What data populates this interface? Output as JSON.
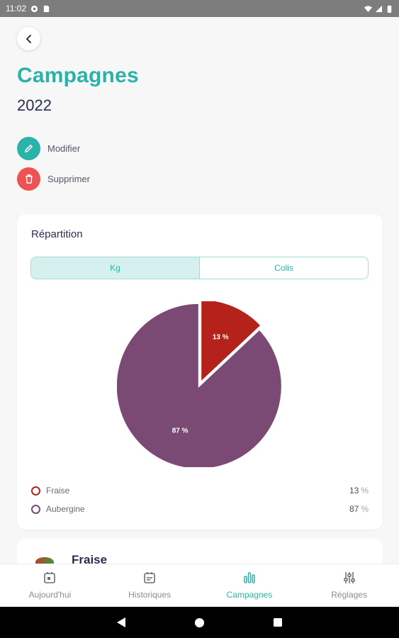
{
  "status_bar": {
    "time": "11:02"
  },
  "header": {
    "title": "Campagnes",
    "subtitle": "2022"
  },
  "actions": {
    "edit_label": "Modifier",
    "delete_label": "Supprimer"
  },
  "repartition_card": {
    "title": "Répartition",
    "tabs": [
      {
        "label": "Kg",
        "active": true
      },
      {
        "label": "Colis",
        "active": false
      }
    ],
    "legend": [
      {
        "name": "Fraise",
        "value": "13",
        "unit": "%",
        "color": "#b5221b"
      },
      {
        "name": "Aubergine",
        "value": "87",
        "unit": "%",
        "color": "#7a4a74"
      }
    ]
  },
  "chart_data": {
    "type": "pie",
    "categories": [
      "Fraise",
      "Aubergine"
    ],
    "values": [
      13,
      87
    ],
    "labels": [
      "13 %",
      "87 %"
    ],
    "colors": [
      "#b5221b",
      "#7a4a74"
    ]
  },
  "next_card": {
    "title": "Fraise"
  },
  "bottom_nav": {
    "items": [
      {
        "label": "Aujourd'hui",
        "icon": "calendar-today-icon",
        "active": false
      },
      {
        "label": "Historiques",
        "icon": "calendar-history-icon",
        "active": false
      },
      {
        "label": "Campagnes",
        "icon": "bar-chart-icon",
        "active": true
      },
      {
        "label": "Réglages",
        "icon": "sliders-icon",
        "active": false
      }
    ]
  },
  "colors": {
    "accent": "#2ab3a9",
    "danger": "#ee5253",
    "title": "#2b2d4f"
  }
}
